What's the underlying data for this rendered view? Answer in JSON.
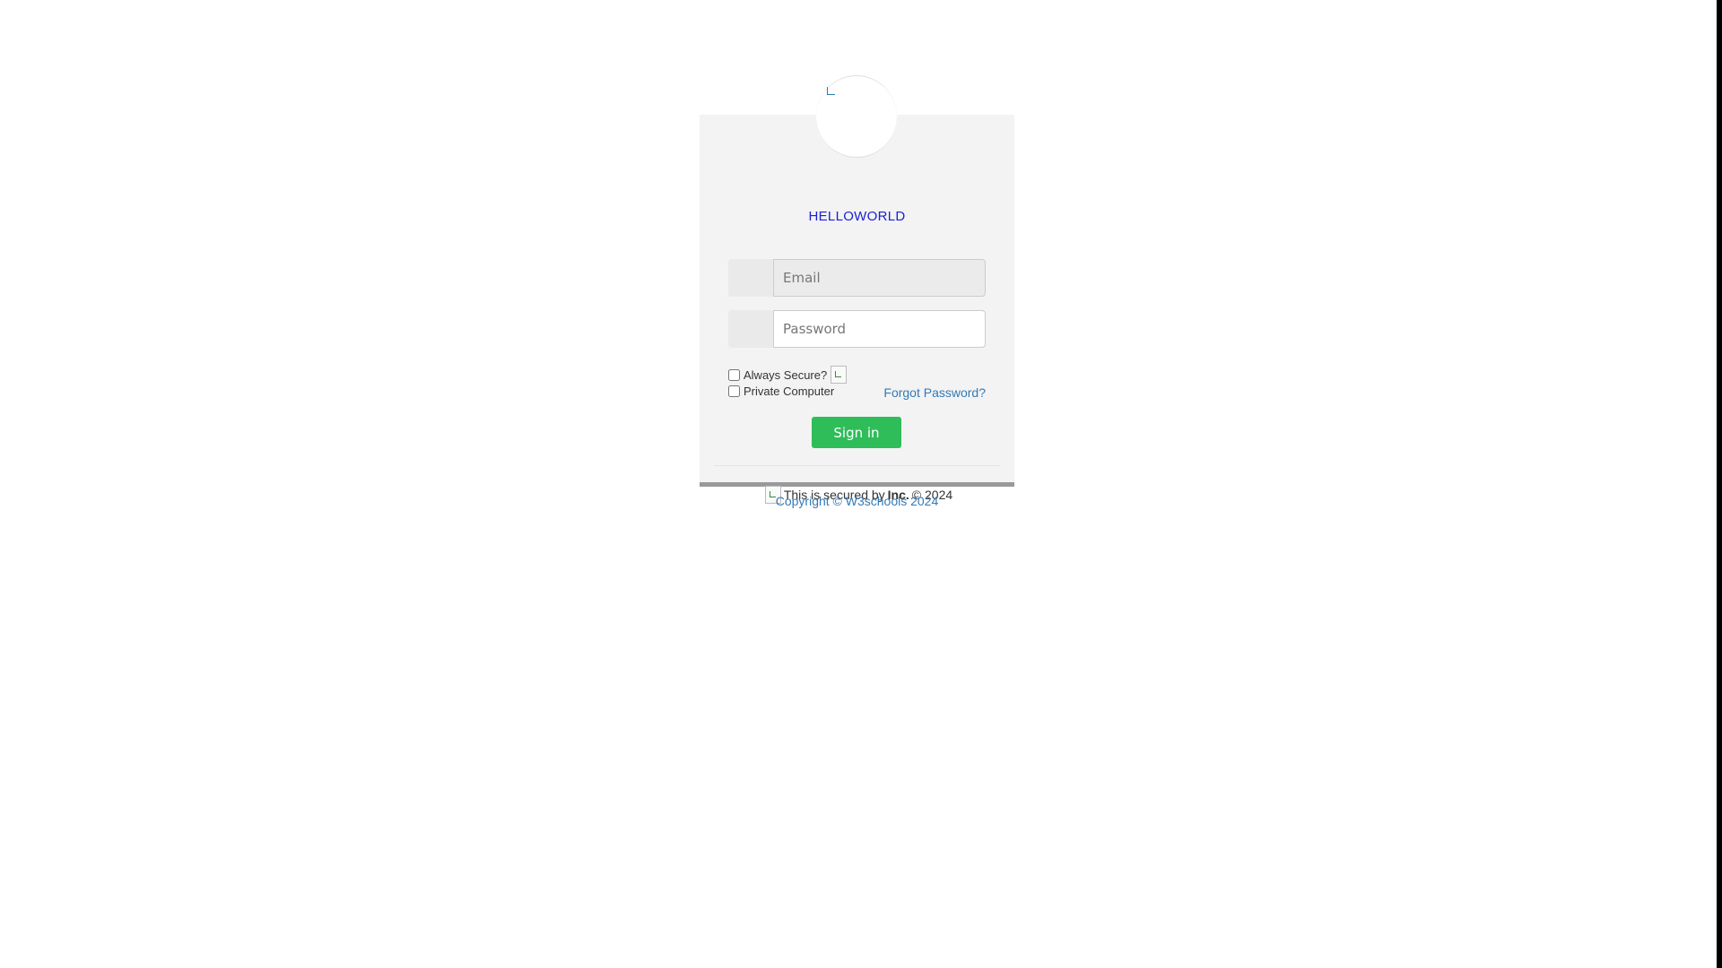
{
  "brand": {
    "name": "HELLOWORLD"
  },
  "form": {
    "email_placeholder": "Email",
    "password_placeholder": "Password",
    "always_secure_label": "Always Secure?",
    "private_computer_label": "Private Computer",
    "forgot_password": "Forgot Password?",
    "signin_label": "Sign in"
  },
  "footer": {
    "secured_prefix": "This is secured by",
    "secured_company": "Inc.",
    "secured_year": "© 2024",
    "copyright": "Copyright © W3schools 2024"
  },
  "colors": {
    "brand_text": "#1a1fd6",
    "signin_button": "#2ebd59",
    "link": "#337ab7"
  }
}
